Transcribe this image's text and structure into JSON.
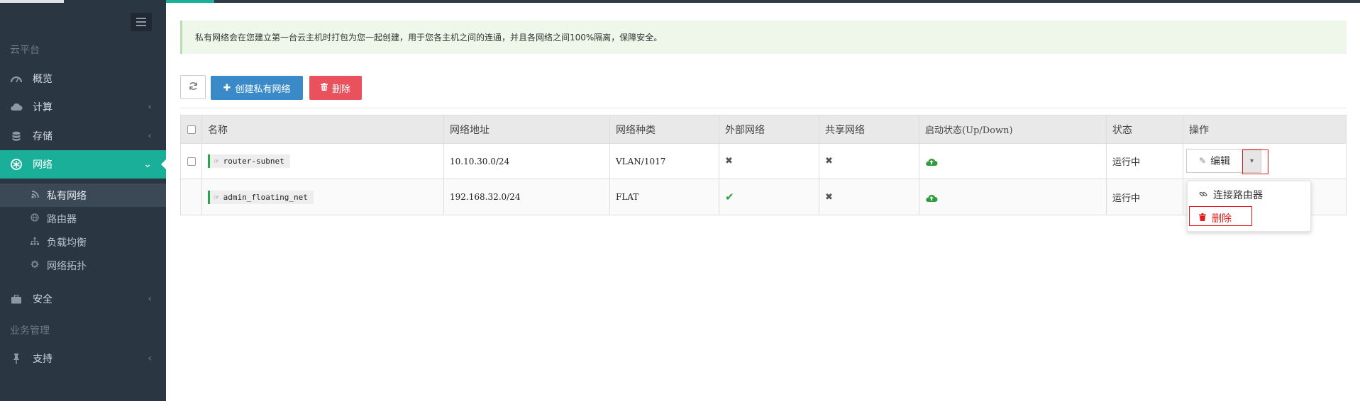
{
  "sidebar": {
    "section_cloud": "云平台",
    "section_business": "业务管理",
    "items": [
      {
        "label": "概览",
        "icon": "dashboard-icon"
      },
      {
        "label": "计算",
        "icon": "cloud-icon"
      },
      {
        "label": "存储",
        "icon": "database-icon"
      },
      {
        "label": "网络",
        "icon": "network-icon"
      },
      {
        "label": "安全",
        "icon": "briefcase-icon"
      },
      {
        "label": "支持",
        "icon": "pin-icon"
      }
    ],
    "network_sub": [
      {
        "label": "私有网络",
        "icon": "rss-icon"
      },
      {
        "label": "路由器",
        "icon": "globe-icon"
      },
      {
        "label": "负载均衡",
        "icon": "sitemap-icon"
      },
      {
        "label": "网络拓扑",
        "icon": "gear-icon"
      }
    ]
  },
  "alert": {
    "text": "私有网络会在您建立第一台云主机时打包为您一起创建，用于您各主机之间的连通，并且各网络之间100%隔离，保障安全。"
  },
  "toolbar": {
    "create_label": "创建私有网络",
    "delete_label": "删除"
  },
  "table": {
    "columns": [
      "名称",
      "网络地址",
      "网络种类",
      "外部网络",
      "共享网络",
      "启动状态(Up/Down)",
      "状态",
      "操作"
    ],
    "rows": [
      {
        "name": "router-subnet",
        "address": "10.10.30.0/24",
        "type": "VLAN/1017",
        "external": false,
        "shared": false,
        "status": "运行中"
      },
      {
        "name": "admin_floating_net",
        "address": "192.168.32.0/24",
        "type": "FLAT",
        "external": true,
        "shared": false,
        "status": "运行中"
      }
    ]
  },
  "actions": {
    "edit_label": "编辑",
    "menu": [
      {
        "label": "连接路由器",
        "icon": "link-icon"
      },
      {
        "label": "删除",
        "icon": "trash-icon"
      }
    ]
  },
  "colors": {
    "sidebar_bg": "#2b3643",
    "accent": "#1aaf99",
    "primary": "#3a8ac9",
    "danger": "#e9525c"
  }
}
